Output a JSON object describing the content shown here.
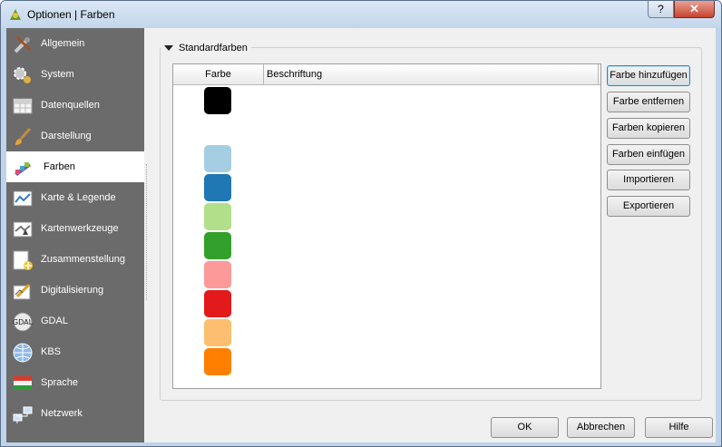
{
  "window": {
    "title": "Optionen | Farben",
    "help_label": "?",
    "close_label": "✕"
  },
  "sidebar": {
    "items": [
      {
        "label": "Allgemein",
        "icon": "tools-icon"
      },
      {
        "label": "System",
        "icon": "gears-icon"
      },
      {
        "label": "Datenquellen",
        "icon": "table-icon"
      },
      {
        "label": "Darstellung",
        "icon": "brush-icon"
      },
      {
        "label": "Farben",
        "icon": "palette-icon",
        "selected": true
      },
      {
        "label": "Karte & Legende",
        "icon": "map-legend-icon"
      },
      {
        "label": "Kartenwerkzeuge",
        "icon": "map-tools-icon"
      },
      {
        "label": "Zusammenstellung",
        "icon": "composer-icon"
      },
      {
        "label": "Digitalisierung",
        "icon": "digitize-icon"
      },
      {
        "label": "GDAL",
        "icon": "gdal-icon"
      },
      {
        "label": "KBS",
        "icon": "globe-icon"
      },
      {
        "label": "Sprache",
        "icon": "language-icon"
      },
      {
        "label": "Netzwerk",
        "icon": "network-icon"
      }
    ]
  },
  "group": {
    "title": "Standardfarben"
  },
  "table": {
    "headers": [
      "Farbe",
      "Beschriftung"
    ],
    "rows": [
      {
        "color": "#000000",
        "label": ""
      },
      {
        "color": "",
        "label": ""
      },
      {
        "color": "#a6cee3",
        "label": ""
      },
      {
        "color": "#1f78b4",
        "label": ""
      },
      {
        "color": "#b2df8a",
        "label": ""
      },
      {
        "color": "#33a02c",
        "label": ""
      },
      {
        "color": "#fb9a99",
        "label": ""
      },
      {
        "color": "#e31a1c",
        "label": ""
      },
      {
        "color": "#fdbf6f",
        "label": ""
      },
      {
        "color": "#ff7f00",
        "label": ""
      }
    ]
  },
  "actions": {
    "add": "Farbe hinzufügen",
    "remove": "Farbe entfernen",
    "copy": "Farben kopieren",
    "paste": "Farben einfügen",
    "import": "Importieren",
    "export": "Exportieren"
  },
  "footer": {
    "ok": "OK",
    "cancel": "Abbrechen",
    "help": "Hilfe"
  },
  "colors": {
    "sidebar_bg": "#6b6b6b",
    "selected_bg": "#ffffff",
    "titlebar": "#c3d6ec"
  }
}
